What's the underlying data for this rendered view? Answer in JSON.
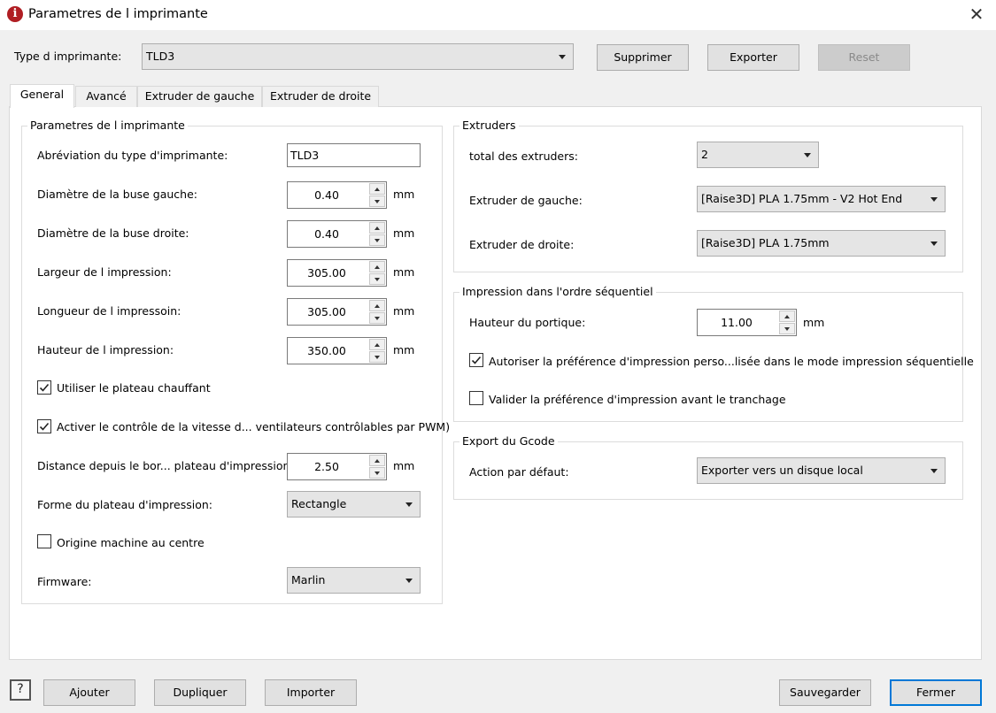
{
  "window": {
    "title": "Parametres de l imprimante",
    "close": "✕"
  },
  "header": {
    "printer_type_label": "Type d imprimante:",
    "printer_type_value": "TLD3",
    "delete_label": "Supprimer",
    "export_label": "Exporter",
    "reset_label": "Reset"
  },
  "tabs": [
    {
      "label": "General"
    },
    {
      "label": "Avancé"
    },
    {
      "label": "Extruder de gauche"
    },
    {
      "label": "Extruder de droite"
    }
  ],
  "printer_params": {
    "title": "Parametres de l imprimante",
    "abbrev_label": "Abréviation du type d'imprimante:",
    "abbrev_value": "TLD3",
    "left_nozzle_label": "Diamètre de la buse gauche:",
    "left_nozzle_value": "0.40",
    "right_nozzle_label": "Diamètre de la buse droite:",
    "right_nozzle_value": "0.40",
    "width_label": "Largeur de l impression:",
    "width_value": "305.00",
    "length_label": "Longueur de l impressoin:",
    "length_value": "305.00",
    "height_label": "Hauteur de l impression:",
    "height_value": "350.00",
    "unit": "mm",
    "heated_bed_label": "Utiliser le plateau chauffant",
    "heated_bed_checked": true,
    "fan_control_label": "Activer le contrôle de la vitesse d... ventilateurs contrôlables par PWM)",
    "fan_control_checked": true,
    "edge_distance_label": "Distance depuis le bor... plateau d'impression:",
    "edge_distance_value": "2.50",
    "bed_shape_label": "Forme du plateau d'impression:",
    "bed_shape_value": "Rectangle",
    "origin_center_label": "Origine machine au centre",
    "origin_center_checked": false,
    "firmware_label": "Firmware:",
    "firmware_value": "Marlin"
  },
  "extruders": {
    "title": "Extruders",
    "total_label": "total des extruders:",
    "total_value": "2",
    "left_label": "Extruder de gauche:",
    "left_value": "[Raise3D] PLA 1.75mm - V2 Hot End",
    "right_label": "Extruder de droite:",
    "right_value": "[Raise3D] PLA 1.75mm"
  },
  "sequential": {
    "title": "Impression dans l'ordre séquentiel",
    "gantry_label": "Hauteur du portique:",
    "gantry_value": "11.00",
    "unit": "mm",
    "allow_custom_label": "Autoriser la préférence d'impression perso...lisée dans le mode impression séquentielle",
    "allow_custom_checked": true,
    "validate_label": "Valider la préférence d'impression avant le tranchage",
    "validate_checked": false
  },
  "gcode_export": {
    "title": "Export du Gcode",
    "default_action_label": "Action par défaut:",
    "default_action_value": "Exporter vers un disque local"
  },
  "footer": {
    "help": "?",
    "add_label": "Ajouter",
    "duplicate_label": "Dupliquer",
    "import_label": "Importer",
    "save_label": "Sauvegarder",
    "close_label": "Fermer"
  },
  "colors": {
    "accent": "#0078d7",
    "app_icon": "#b01e23"
  }
}
